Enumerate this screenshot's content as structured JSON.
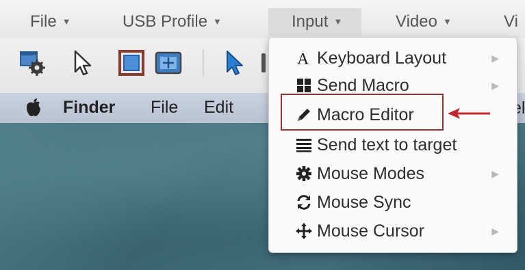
{
  "menubar": {
    "items": [
      {
        "label": "File",
        "caret": "▼"
      },
      {
        "label": "USB Profile",
        "caret": "▼"
      },
      {
        "label": "Input",
        "caret": "▼"
      },
      {
        "label": "Video",
        "caret": "▼"
      },
      {
        "label": "Vi"
      }
    ]
  },
  "toolbar": {
    "icons": [
      "settings-window-icon",
      "pointer-icon",
      "fullscreen-icon",
      "fit-screen-icon",
      "blue-pointer-icon"
    ]
  },
  "remote_menubar": {
    "apple": "apple-logo-icon",
    "items": [
      {
        "label": "Finder"
      },
      {
        "label": "File"
      },
      {
        "label": "Edit"
      }
    ],
    "peek_text": "el"
  },
  "dropdown": {
    "items": [
      {
        "label": "Keyboard Layout",
        "icon": "letter-a-icon",
        "submenu": "▶"
      },
      {
        "label": "Send Macro",
        "icon": "grid-icon",
        "submenu": "▶"
      },
      {
        "label": "Macro Editor",
        "icon": "pencil-icon"
      },
      {
        "label": "Send text to target",
        "icon": "lines-icon"
      },
      {
        "label": "Mouse Modes",
        "icon": "gear-icon",
        "submenu": "▶"
      },
      {
        "label": "Mouse Sync",
        "icon": "sync-icon"
      },
      {
        "label": "Mouse Cursor",
        "icon": "move-icon",
        "submenu": "▶"
      }
    ],
    "highlighted_item": "Macro Editor"
  },
  "colors": {
    "highlight_border": "#9b3030",
    "arrow": "#c0282e"
  }
}
